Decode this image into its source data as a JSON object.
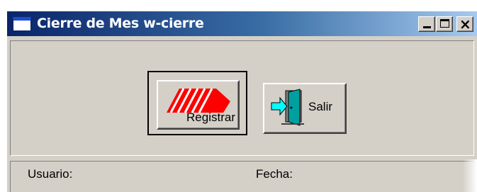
{
  "window": {
    "title": "Cierre de Mes w-cierre",
    "controls": {
      "minimize_icon": "minimize-icon",
      "maximize_icon": "maximize-icon",
      "close_icon": "close-icon",
      "close_glyph": "×"
    }
  },
  "toolbar": {
    "registrar_label": "Registrar",
    "registrar_icon": "stamp-arrow-icon",
    "salir_label": "Salir",
    "salir_icon": "exit-door-icon"
  },
  "statusbar": {
    "usuario_label": "Usuario:",
    "fecha_label": "Fecha:"
  },
  "colors": {
    "titlebar_start": "#0a246a",
    "titlebar_end": "#a6caf0",
    "face": "#d4d0c8",
    "registrar_icon_red": "#ff0000",
    "salir_icon_teal": "#00a0a0"
  }
}
